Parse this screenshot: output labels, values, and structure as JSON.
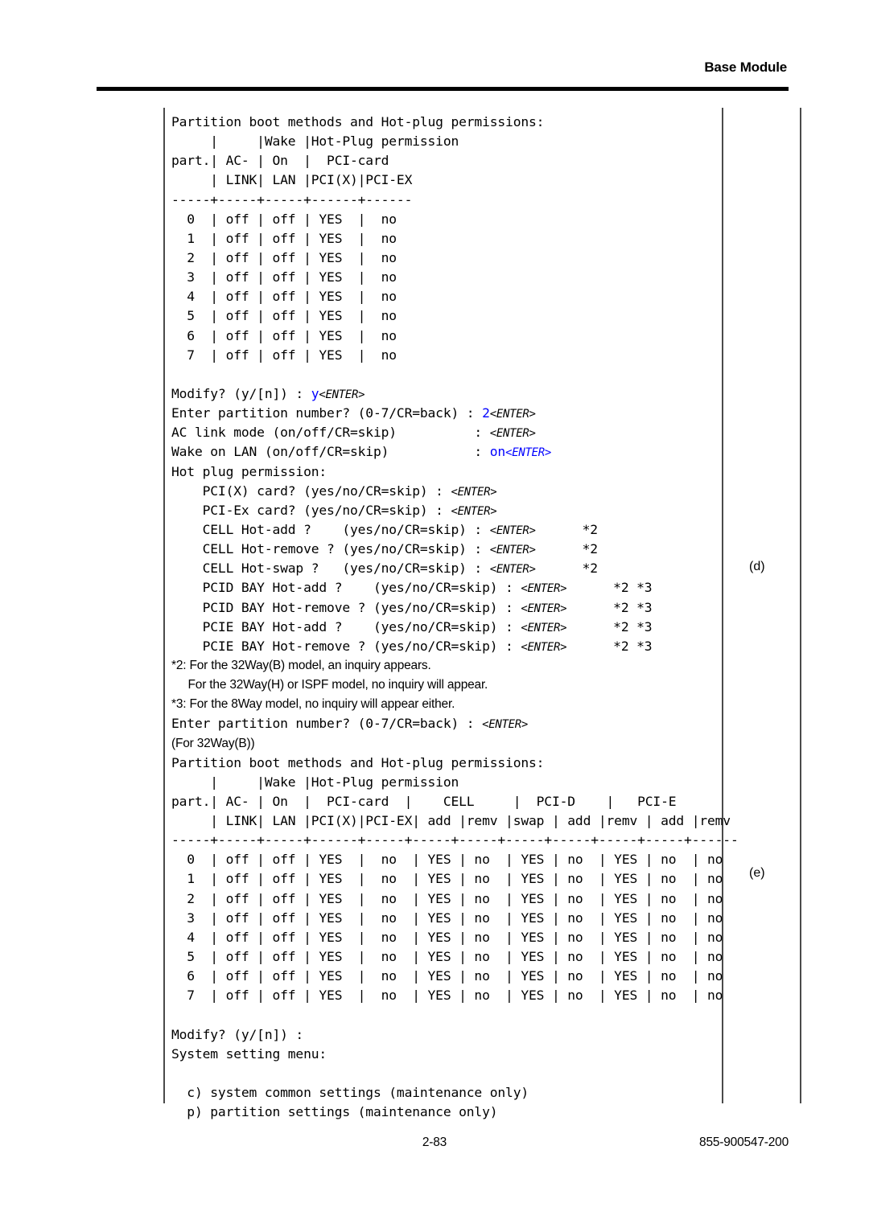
{
  "header": {
    "title": "Base Module"
  },
  "footer": {
    "page_number": "2-83",
    "document_number": "855-900547-200"
  },
  "callouts": {
    "d": "(d)",
    "e": "(e)"
  },
  "colors": {
    "user_input": "#0000FF",
    "text": "#000000",
    "rule": "#4A4A4A"
  },
  "terminal": {
    "block_a": {
      "title": "Partition boot methods and Hot-plug permissions:",
      "header_rows": [
        "     |     |Wake |Hot-Plug permission",
        "part.| AC- | On  |  PCI-card",
        "     | LINK| LAN |PCI(X)|PCI-EX"
      ],
      "separator": "-----+-----+-----+------+------",
      "columns": [
        "part.",
        "AC-LINK",
        "Wake On LAN",
        "PCI(X)",
        "PCI-EX"
      ],
      "rows": [
        {
          "part": "0",
          "ac_link": "off",
          "wake_on_lan": "off",
          "pci_x": "YES",
          "pci_ex": "no"
        },
        {
          "part": "1",
          "ac_link": "off",
          "wake_on_lan": "off",
          "pci_x": "YES",
          "pci_ex": "no"
        },
        {
          "part": "2",
          "ac_link": "off",
          "wake_on_lan": "off",
          "pci_x": "YES",
          "pci_ex": "no"
        },
        {
          "part": "3",
          "ac_link": "off",
          "wake_on_lan": "off",
          "pci_x": "YES",
          "pci_ex": "no"
        },
        {
          "part": "4",
          "ac_link": "off",
          "wake_on_lan": "off",
          "pci_x": "YES",
          "pci_ex": "no"
        },
        {
          "part": "5",
          "ac_link": "off",
          "wake_on_lan": "off",
          "pci_x": "YES",
          "pci_ex": "no"
        },
        {
          "part": "6",
          "ac_link": "off",
          "wake_on_lan": "off",
          "pci_x": "YES",
          "pci_ex": "no"
        },
        {
          "part": "7",
          "ac_link": "off",
          "wake_on_lan": "off",
          "pci_x": "YES",
          "pci_ex": "no"
        }
      ]
    },
    "prompts": [
      {
        "label": "Modify? (y/[n]) : ",
        "value": "y",
        "enter": "<ENTER>",
        "enter_blue": false
      },
      {
        "label": "Enter partition number? (0-7/CR=back) : ",
        "value": "2",
        "enter": "<ENTER>",
        "enter_blue": false
      },
      {
        "label": "AC link mode (on/off/CR=skip)          : ",
        "value": "",
        "enter": "<ENTER>",
        "enter_blue": false
      },
      {
        "label": "Wake on LAN (on/off/CR=skip)           : ",
        "value": "on",
        "enter": "<ENTER>",
        "enter_blue": true
      }
    ],
    "hot_plug_title": "Hot plug permission:",
    "hot_plug_prompts": [
      {
        "label": "    PCI(X) card? (yes/no/CR=skip) : ",
        "enter": "<ENTER>",
        "note": ""
      },
      {
        "label": "    PCI-Ex card? (yes/no/CR=skip) : ",
        "enter": "<ENTER>",
        "note": ""
      },
      {
        "label": "    CELL Hot-add ?    (yes/no/CR=skip) : ",
        "enter": "<ENTER>",
        "note": "*2"
      },
      {
        "label": "    CELL Hot-remove ? (yes/no/CR=skip) : ",
        "enter": "<ENTER>",
        "note": "*2"
      },
      {
        "label": "    CELL Hot-swap ?   (yes/no/CR=skip) : ",
        "enter": "<ENTER>",
        "note": "*2"
      },
      {
        "label": "    PCID BAY Hot-add ?    (yes/no/CR=skip) : ",
        "enter": "<ENTER>",
        "note": "*2 *3"
      },
      {
        "label": "    PCID BAY Hot-remove ? (yes/no/CR=skip) : ",
        "enter": "<ENTER>",
        "note": "*2 *3"
      },
      {
        "label": "    PCIE BAY Hot-add ?    (yes/no/CR=skip) : ",
        "enter": "<ENTER>",
        "note": "*2 *3"
      },
      {
        "label": "    PCIE BAY Hot-remove ? (yes/no/CR=skip) : ",
        "enter": "<ENTER>",
        "note": "*2 *3"
      }
    ],
    "footnotes": [
      "*2: For the 32Way(B) model, an inquiry appears.",
      "     For the 32Way(H) or ISPF model, no inquiry will appear.",
      "*3: For the 8Way model, no inquiry will appear either."
    ],
    "post_footnote_prompt": {
      "label": "Enter partition number? (0-7/CR=back) : ",
      "enter": "<ENTER>"
    },
    "for_model_note": "(For 32Way(B))",
    "block_b": {
      "title": "Partition boot methods and Hot-plug permissions:",
      "header_rows": [
        "     |     |Wake |Hot-Plug permission",
        "part.| AC- | On  |  PCI-card  |    CELL     |  PCI-D    |   PCI-E",
        "     | LINK| LAN |PCI(X)|PCI-EX| add |remv |swap | add |remv | add |remv"
      ],
      "separator": "-----+-----+-----+------+-----+-----+-----+-----+-----+-----+-----+------",
      "columns": [
        "part.",
        "AC-LINK",
        "Wake On LAN",
        "PCI(X)",
        "PCI-EX",
        "CELL add",
        "CELL remv",
        "CELL swap",
        "PCI-D add",
        "PCI-D remv",
        "PCI-E add",
        "PCI-E remv"
      ],
      "rows": [
        {
          "part": "0",
          "ac_link": "off",
          "wake_on_lan": "off",
          "pci_x": "YES",
          "pci_ex": "no",
          "cell_add": "YES",
          "cell_remv": "no",
          "cell_swap": "YES",
          "pcid_add": "no",
          "pcid_remv": "YES",
          "pcie_add": "no",
          "pcie_remv": "no"
        },
        {
          "part": "1",
          "ac_link": "off",
          "wake_on_lan": "off",
          "pci_x": "YES",
          "pci_ex": "no",
          "cell_add": "YES",
          "cell_remv": "no",
          "cell_swap": "YES",
          "pcid_add": "no",
          "pcid_remv": "YES",
          "pcie_add": "no",
          "pcie_remv": "no"
        },
        {
          "part": "2",
          "ac_link": "off",
          "wake_on_lan": "off",
          "pci_x": "YES",
          "pci_ex": "no",
          "cell_add": "YES",
          "cell_remv": "no",
          "cell_swap": "YES",
          "pcid_add": "no",
          "pcid_remv": "YES",
          "pcie_add": "no",
          "pcie_remv": "no"
        },
        {
          "part": "3",
          "ac_link": "off",
          "wake_on_lan": "off",
          "pci_x": "YES",
          "pci_ex": "no",
          "cell_add": "YES",
          "cell_remv": "no",
          "cell_swap": "YES",
          "pcid_add": "no",
          "pcid_remv": "YES",
          "pcie_add": "no",
          "pcie_remv": "no"
        },
        {
          "part": "4",
          "ac_link": "off",
          "wake_on_lan": "off",
          "pci_x": "YES",
          "pci_ex": "no",
          "cell_add": "YES",
          "cell_remv": "no",
          "cell_swap": "YES",
          "pcid_add": "no",
          "pcid_remv": "YES",
          "pcie_add": "no",
          "pcie_remv": "no"
        },
        {
          "part": "5",
          "ac_link": "off",
          "wake_on_lan": "off",
          "pci_x": "YES",
          "pci_ex": "no",
          "cell_add": "YES",
          "cell_remv": "no",
          "cell_swap": "YES",
          "pcid_add": "no",
          "pcid_remv": "YES",
          "pcie_add": "no",
          "pcie_remv": "no"
        },
        {
          "part": "6",
          "ac_link": "off",
          "wake_on_lan": "off",
          "pci_x": "YES",
          "pci_ex": "no",
          "cell_add": "YES",
          "cell_remv": "no",
          "cell_swap": "YES",
          "pcid_add": "no",
          "pcid_remv": "YES",
          "pcie_add": "no",
          "pcie_remv": "no"
        },
        {
          "part": "7",
          "ac_link": "off",
          "wake_on_lan": "off",
          "pci_x": "YES",
          "pci_ex": "no",
          "cell_add": "YES",
          "cell_remv": "no",
          "cell_swap": "YES",
          "pcid_add": "no",
          "pcid_remv": "YES",
          "pcie_add": "no",
          "pcie_remv": "no"
        }
      ]
    },
    "final_prompt": "Modify? (y/[n]) : ",
    "menu_title": "System setting menu:",
    "menu_items": [
      "  c) system common settings (maintenance only)",
      "  p) partition settings (maintenance only)"
    ]
  }
}
